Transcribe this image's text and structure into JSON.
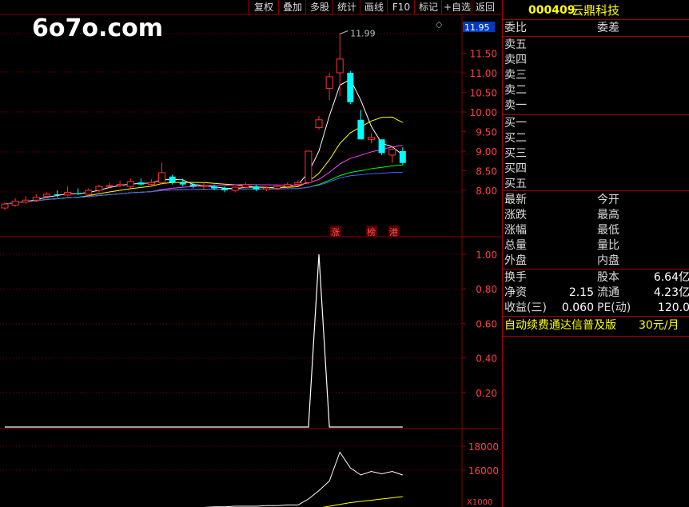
{
  "toolbar": {
    "buttons": [
      "复权",
      "叠加",
      "多股",
      "统计",
      "画线",
      "F10",
      "标记",
      "+自选",
      "返回"
    ]
  },
  "watermark": "6o7o.com",
  "price_label_box": "11.95",
  "peak_annotation": "11.99",
  "event_tags": [
    "涨",
    "榜",
    "港"
  ],
  "chart_data": [
    {
      "type": "candlestick",
      "title": "",
      "y_ticks": [
        "11.50",
        "11.00",
        "10.50",
        "10.00",
        "9.50",
        "9.00",
        "8.50",
        "8.00"
      ],
      "ylim": [
        7.5,
        12.1
      ],
      "candles": [
        {
          "o": 7.55,
          "h": 7.7,
          "l": 7.5,
          "c": 7.65
        },
        {
          "o": 7.62,
          "h": 7.8,
          "l": 7.58,
          "c": 7.72
        },
        {
          "o": 7.7,
          "h": 7.85,
          "l": 7.65,
          "c": 7.75
        },
        {
          "o": 7.75,
          "h": 7.9,
          "l": 7.7,
          "c": 7.82
        },
        {
          "o": 7.85,
          "h": 7.95,
          "l": 7.8,
          "c": 7.9
        },
        {
          "o": 7.9,
          "h": 8.0,
          "l": 7.82,
          "c": 7.88
        },
        {
          "o": 7.88,
          "h": 8.1,
          "l": 7.85,
          "c": 7.95
        },
        {
          "o": 7.92,
          "h": 8.05,
          "l": 7.88,
          "c": 7.9
        },
        {
          "o": 7.9,
          "h": 8.05,
          "l": 7.85,
          "c": 8.0
        },
        {
          "o": 8.0,
          "h": 8.15,
          "l": 7.95,
          "c": 8.1
        },
        {
          "o": 8.1,
          "h": 8.2,
          "l": 8.05,
          "c": 8.12
        },
        {
          "o": 8.12,
          "h": 8.25,
          "l": 8.08,
          "c": 8.15
        },
        {
          "o": 8.1,
          "h": 8.3,
          "l": 8.05,
          "c": 8.22
        },
        {
          "o": 8.2,
          "h": 8.3,
          "l": 8.12,
          "c": 8.15
        },
        {
          "o": 8.15,
          "h": 8.28,
          "l": 8.1,
          "c": 8.2
        },
        {
          "o": 8.2,
          "h": 8.7,
          "l": 8.15,
          "c": 8.45
        },
        {
          "o": 8.35,
          "h": 8.4,
          "l": 8.15,
          "c": 8.2
        },
        {
          "o": 8.2,
          "h": 8.3,
          "l": 8.1,
          "c": 8.15
        },
        {
          "o": 8.15,
          "h": 8.2,
          "l": 8.05,
          "c": 8.1
        },
        {
          "o": 8.1,
          "h": 8.2,
          "l": 8.0,
          "c": 8.12
        },
        {
          "o": 8.1,
          "h": 8.15,
          "l": 8.0,
          "c": 8.05
        },
        {
          "o": 8.05,
          "h": 8.1,
          "l": 7.95,
          "c": 8.0
        },
        {
          "o": 8.0,
          "h": 8.1,
          "l": 7.95,
          "c": 8.08
        },
        {
          "o": 8.08,
          "h": 8.2,
          "l": 8.05,
          "c": 8.15
        },
        {
          "o": 8.1,
          "h": 8.15,
          "l": 7.98,
          "c": 8.02
        },
        {
          "o": 8.02,
          "h": 8.1,
          "l": 7.98,
          "c": 8.06
        },
        {
          "o": 8.05,
          "h": 8.15,
          "l": 8.0,
          "c": 8.1
        },
        {
          "o": 8.1,
          "h": 8.2,
          "l": 8.05,
          "c": 8.15
        },
        {
          "o": 8.15,
          "h": 8.25,
          "l": 8.1,
          "c": 8.2
        },
        {
          "o": 8.2,
          "h": 8.9,
          "l": 8.15,
          "c": 9.0
        },
        {
          "o": 9.6,
          "h": 9.9,
          "l": 9.55,
          "c": 9.8
        },
        {
          "o": 10.6,
          "h": 11.0,
          "l": 10.3,
          "c": 10.9
        },
        {
          "o": 11.0,
          "h": 11.99,
          "l": 10.4,
          "c": 11.35
        },
        {
          "o": 11.0,
          "h": 11.05,
          "l": 10.2,
          "c": 10.25
        },
        {
          "o": 9.8,
          "h": 10.05,
          "l": 9.3,
          "c": 9.3
        },
        {
          "o": 9.3,
          "h": 9.45,
          "l": 9.2,
          "c": 9.35
        },
        {
          "o": 9.3,
          "h": 9.3,
          "l": 8.9,
          "c": 8.95
        },
        {
          "o": 8.9,
          "h": 9.1,
          "l": 8.7,
          "c": 9.05
        },
        {
          "o": 9.0,
          "h": 9.1,
          "l": 8.65,
          "c": 8.7
        }
      ]
    },
    {
      "type": "line",
      "y_ticks": [
        "1.00",
        "0.80",
        "0.60",
        "0.40",
        "0.20"
      ],
      "ylim": [
        0,
        1.0
      ],
      "values": [
        0,
        0,
        0,
        0,
        0,
        0,
        0,
        0,
        0,
        0,
        0,
        0,
        0,
        0,
        0,
        0,
        0,
        0,
        0,
        0,
        0,
        0,
        0,
        0,
        0,
        0,
        0,
        0,
        0,
        0,
        1.0,
        0,
        0,
        0,
        0,
        0,
        0,
        0,
        0
      ]
    },
    {
      "type": "line",
      "y_ticks": [
        "18000",
        "16000"
      ],
      "multiplier": "X1000",
      "ylim": [
        12000,
        19000
      ],
      "series": [
        {
          "values": [
            12200,
            12250,
            12300,
            12350,
            12400,
            12450,
            12500,
            12500,
            12550,
            12600,
            12650,
            12700,
            12700,
            12750,
            12800,
            12800,
            12850,
            12850,
            12900,
            12900,
            12950,
            12950,
            13000,
            13000,
            13000,
            13050,
            13050,
            13100,
            13100,
            13600,
            14300,
            15100,
            17500,
            16200,
            15600,
            15900,
            15700,
            15900,
            15600
          ]
        },
        {
          "values": [
            12100,
            12120,
            12140,
            12160,
            12180,
            12200,
            12220,
            12240,
            12260,
            12280,
            12300,
            12320,
            12340,
            12360,
            12380,
            12400,
            12420,
            12440,
            12460,
            12480,
            12500,
            12520,
            12540,
            12560,
            12580,
            12600,
            12620,
            12640,
            12660,
            12720,
            12850,
            13000,
            13150,
            13300,
            13400,
            13500,
            13600,
            13700,
            13800
          ]
        }
      ]
    }
  ],
  "quote_panel": {
    "code": "000409",
    "name": "云鼎科技",
    "weibi_label": "委比",
    "weicha_label": "委差",
    "sell_levels": [
      "卖五",
      "卖四",
      "卖三",
      "卖二",
      "卖一"
    ],
    "buy_levels": [
      "买一",
      "买二",
      "买三",
      "买四",
      "买五"
    ],
    "stats_left": [
      "最新",
      "涨跌",
      "涨幅",
      "总量",
      "外盘"
    ],
    "stats_right": [
      "今开",
      "最高",
      "最低",
      "量比",
      "内盘"
    ],
    "fund": {
      "huanshou_label": "换手",
      "guben_label": "股本",
      "guben_value": "6.64亿",
      "jingzi_label": "净资",
      "jingzi_value": "2.15",
      "liutong_label": "流通",
      "liutong_value": "4.23亿",
      "shouyi_label": "收益(三)",
      "shouyi_value": "0.060",
      "pe_label": "PE(动)",
      "pe_value": "120.0"
    },
    "ad_text": "自动续费通达信普及版",
    "ad_price": "30元/月"
  },
  "colors": {
    "up": "#ff3232",
    "down": "#00ffff",
    "grid": "#8a0000",
    "ma1": "#ffffff",
    "ma2": "#ffff00",
    "ma3": "#ff44ff",
    "ma4": "#00ff00",
    "ma5": "#4466ff"
  }
}
